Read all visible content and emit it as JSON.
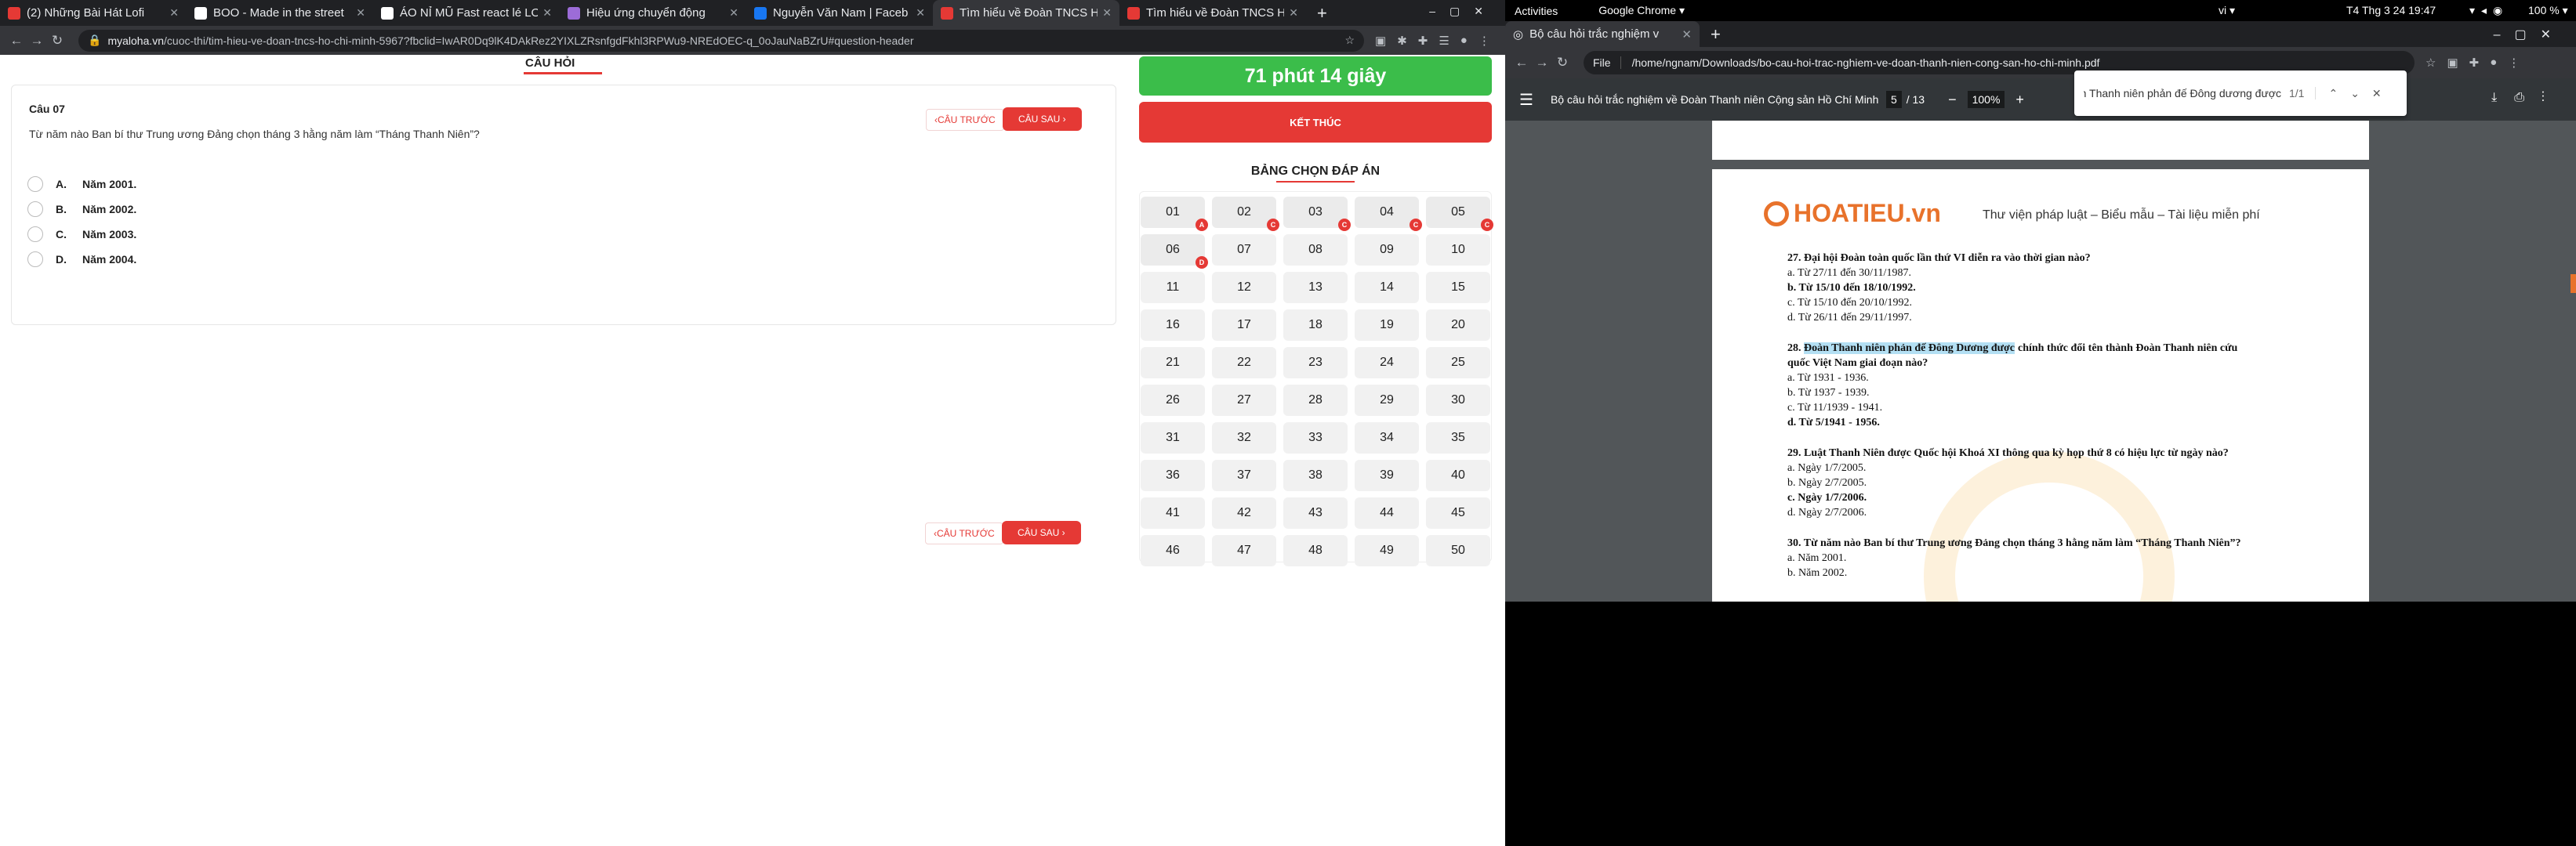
{
  "left_browser": {
    "tabs": [
      {
        "title": "(2) Những Bài Hát Lofi",
        "color": "#e53935"
      },
      {
        "title": "BOO - Made in the street",
        "color": "#ffffff"
      },
      {
        "title": "ÁO NỈ MŨ Fast react lé LO",
        "color": "#ffffff"
      },
      {
        "title": "Hiệu ứng chuyển động",
        "color": "#9c6cd8"
      },
      {
        "title": "Nguyễn Văn Nam | Faceb",
        "color": "#1877f2"
      },
      {
        "title": "Tìm hiểu về Đoàn TNCS H",
        "color": "#e53935"
      },
      {
        "title": "Tìm hiểu về Đoàn TNCS H",
        "color": "#e53935"
      }
    ],
    "url_host": "myaloha.vn",
    "url_path": "/cuoc-thi/tim-hieu-ve-doan-tncs-ho-chi-minh-5967?fbclid=IwAR0Dq9lK4DAkRez2YIXLZRsnfgdFkhl3RPWu9-NREdOEC-q_0oJauNaBZrU#question-header"
  },
  "quiz": {
    "section_title": "CÂU HỎI",
    "question_number": "Câu 07",
    "question_text": "Từ năm nào Ban bí thư Trung ương Đảng chọn tháng 3 hằng năm làm “Tháng Thanh Niên”?",
    "options": [
      {
        "letter": "A.",
        "text": "Năm 2001."
      },
      {
        "letter": "B.",
        "text": "Năm 2002."
      },
      {
        "letter": "C.",
        "text": "Năm 2003."
      },
      {
        "letter": "D.",
        "text": "Năm 2004."
      }
    ],
    "prev_label": "‹CÂU TRƯỚC",
    "next_label": "CÂU SAU ›",
    "timer": "71 phút 14 giây",
    "finish_label": "KẾT THÚC",
    "grid_title": "BẢNG CHỌN ĐÁP ÁN",
    "cells": [
      {
        "n": "01",
        "b": "A"
      },
      {
        "n": "02",
        "b": "C"
      },
      {
        "n": "03",
        "b": "C"
      },
      {
        "n": "04",
        "b": "C"
      },
      {
        "n": "05",
        "b": "C"
      },
      {
        "n": "06",
        "b": "D"
      },
      {
        "n": "07",
        "b": ""
      },
      {
        "n": "08",
        "b": ""
      },
      {
        "n": "09",
        "b": ""
      },
      {
        "n": "10",
        "b": ""
      },
      {
        "n": "11",
        "b": ""
      },
      {
        "n": "12",
        "b": ""
      },
      {
        "n": "13",
        "b": ""
      },
      {
        "n": "14",
        "b": ""
      },
      {
        "n": "15",
        "b": ""
      },
      {
        "n": "16",
        "b": ""
      },
      {
        "n": "17",
        "b": ""
      },
      {
        "n": "18",
        "b": ""
      },
      {
        "n": "19",
        "b": ""
      },
      {
        "n": "20",
        "b": ""
      },
      {
        "n": "21",
        "b": ""
      },
      {
        "n": "22",
        "b": ""
      },
      {
        "n": "23",
        "b": ""
      },
      {
        "n": "24",
        "b": ""
      },
      {
        "n": "25",
        "b": ""
      },
      {
        "n": "26",
        "b": ""
      },
      {
        "n": "27",
        "b": ""
      },
      {
        "n": "28",
        "b": ""
      },
      {
        "n": "29",
        "b": ""
      },
      {
        "n": "30",
        "b": ""
      },
      {
        "n": "31",
        "b": ""
      },
      {
        "n": "32",
        "b": ""
      },
      {
        "n": "33",
        "b": ""
      },
      {
        "n": "34",
        "b": ""
      },
      {
        "n": "35",
        "b": ""
      },
      {
        "n": "36",
        "b": ""
      },
      {
        "n": "37",
        "b": ""
      },
      {
        "n": "38",
        "b": ""
      },
      {
        "n": "39",
        "b": ""
      },
      {
        "n": "40",
        "b": ""
      },
      {
        "n": "41",
        "b": ""
      },
      {
        "n": "42",
        "b": ""
      },
      {
        "n": "43",
        "b": ""
      },
      {
        "n": "44",
        "b": ""
      },
      {
        "n": "45",
        "b": ""
      },
      {
        "n": "46",
        "b": ""
      },
      {
        "n": "47",
        "b": ""
      },
      {
        "n": "48",
        "b": ""
      },
      {
        "n": "49",
        "b": ""
      },
      {
        "n": "50",
        "b": ""
      }
    ]
  },
  "gnome": {
    "activities": "Activities",
    "app": "Google Chrome ▾",
    "lang": "vi ▾",
    "clock": "T4 Thg 3 24  19:47",
    "battery": "100 % ▾"
  },
  "right_browser": {
    "tab_title": "Bộ câu hỏi trắc nghiệm v",
    "file_label": "File",
    "path": "/home/ngnam/Downloads/bo-cau-hoi-trac-nghiem-ve-doan-thanh-nien-cong-san-ho-chi-minh.pdf",
    "doc_title": "Bộ câu hỏi trắc nghiệm về Đoàn Thanh niên Cộng sản Hồ Chí Minh - H...",
    "page_current": "5",
    "page_total": "/ 13",
    "zoom": "100%",
    "find_query": "Đoàn Thanh niên phản đế Đông dương được",
    "find_count": "1/1"
  },
  "pdf": {
    "logo": "HOATIEU.vn",
    "tagline": "Thư viện pháp luật – Biểu mẫu – Tài liệu miễn phí",
    "lines": [
      {
        "t": "27. Đại hội Đoàn toàn quốc lần thứ VI diễn ra vào thời gian nào?",
        "b": true
      },
      {
        "t": "a. Từ 27/11 đến 30/11/1987.",
        "b": false
      },
      {
        "t": "b. Từ 15/10 đến 18/10/1992.",
        "b": true
      },
      {
        "t": "c. Từ 15/10 đến 20/10/1992.",
        "b": false
      },
      {
        "t": "d. Từ 26/11 đến 29/11/1997.",
        "b": false
      },
      {
        "t": "",
        "b": false
      },
      {
        "t": "chính thức đổi tên thành Đoàn Thanh niên cứu",
        "b": true,
        "pre": "28. ",
        "hl": "Đoàn Thanh niên phản đế Đông Dương được"
      },
      {
        "t": "quốc Việt Nam giai đoạn nào?",
        "b": true
      },
      {
        "t": "a. Từ 1931 - 1936.",
        "b": false
      },
      {
        "t": "b. Từ 1937 - 1939.",
        "b": false
      },
      {
        "t": "c. Từ 11/1939 - 1941.",
        "b": false
      },
      {
        "t": "d. Từ 5/1941 - 1956.",
        "b": true
      },
      {
        "t": "",
        "b": false
      },
      {
        "t": "29. Luật Thanh Niên được Quốc hội Khoá XI thông qua kỳ họp thứ 8 có hiệu lực từ ngày nào?",
        "b": true
      },
      {
        "t": "a. Ngày 1/7/2005.",
        "b": false
      },
      {
        "t": "b. Ngày 2/7/2005.",
        "b": false
      },
      {
        "t": "c. Ngày 1/7/2006.",
        "b": true
      },
      {
        "t": "d. Ngày 2/7/2006.",
        "b": false
      },
      {
        "t": "",
        "b": false
      },
      {
        "t": "30. Từ năm nào Ban bí thư Trung ương Đảng chọn tháng 3 hằng năm làm “Tháng Thanh Niên”?",
        "b": true
      },
      {
        "t": "a. Năm 2001.",
        "b": false
      },
      {
        "t": "b. Năm 2002.",
        "b": false
      }
    ]
  }
}
